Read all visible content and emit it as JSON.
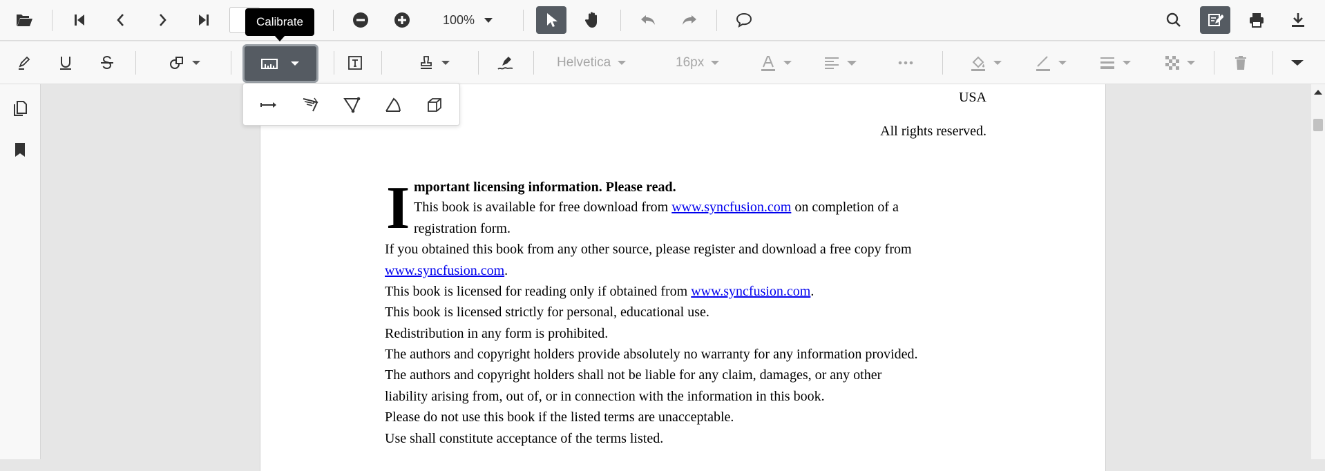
{
  "toolbar": {
    "zoom_value": "100%",
    "page_number": ""
  },
  "annotation_toolbar": {
    "font_family": "Helvetica",
    "font_size": "16px"
  },
  "tooltip": {
    "text": "Calibrate"
  },
  "document": {
    "country": "USA",
    "rights": "All rights reserved.",
    "drop_cap": "I",
    "heading_rest": "mportant licensing information. Please read.",
    "line1_pre": "This book is available for free download from ",
    "line1_link": "www.syncfusion.com",
    "line1_post": " on completion of a",
    "line2": "registration form.",
    "line3": "If you obtained this book from any other source, please register and download a free copy from",
    "line4_link": "www.syncfusion.com",
    "line4_post": ".",
    "line5_pre": "This book is licensed for reading only if obtained from ",
    "line5_link": "www.syncfusion.com",
    "line5_post": ".",
    "line6": "This book is licensed strictly for personal, educational use.",
    "line7": "Redistribution in any form is prohibited.",
    "line8": "The authors and copyright holders provide absolutely no warranty for any information provided.",
    "line9": "The authors and copyright holders shall not be liable for any claim, damages, or any other",
    "line10": "liability arising from, out of, or in connection with the information in this book.",
    "line11": "Please do not use this book if the listed terms are unacceptable.",
    "line12": "Use shall constitute acceptance of the terms listed."
  },
  "icons": {
    "open": "folder-open-icon",
    "first": "first-page-icon",
    "prev": "previous-page-icon",
    "next": "next-page-icon",
    "last": "last-page-icon",
    "zoom_out": "zoom-out-icon",
    "zoom_in": "zoom-in-icon",
    "select": "select-cursor-icon",
    "pan": "pan-hand-icon",
    "undo": "undo-icon",
    "redo": "redo-icon",
    "comment": "comment-icon",
    "search": "search-icon",
    "edit_annotation": "edit-annotation-icon",
    "print": "print-icon",
    "download": "download-icon"
  },
  "colors": {
    "active_button": "#555b62",
    "link": "#0000ee",
    "toolbar_bg": "#f8f8f8",
    "viewer_bg": "#e6e6e6"
  }
}
